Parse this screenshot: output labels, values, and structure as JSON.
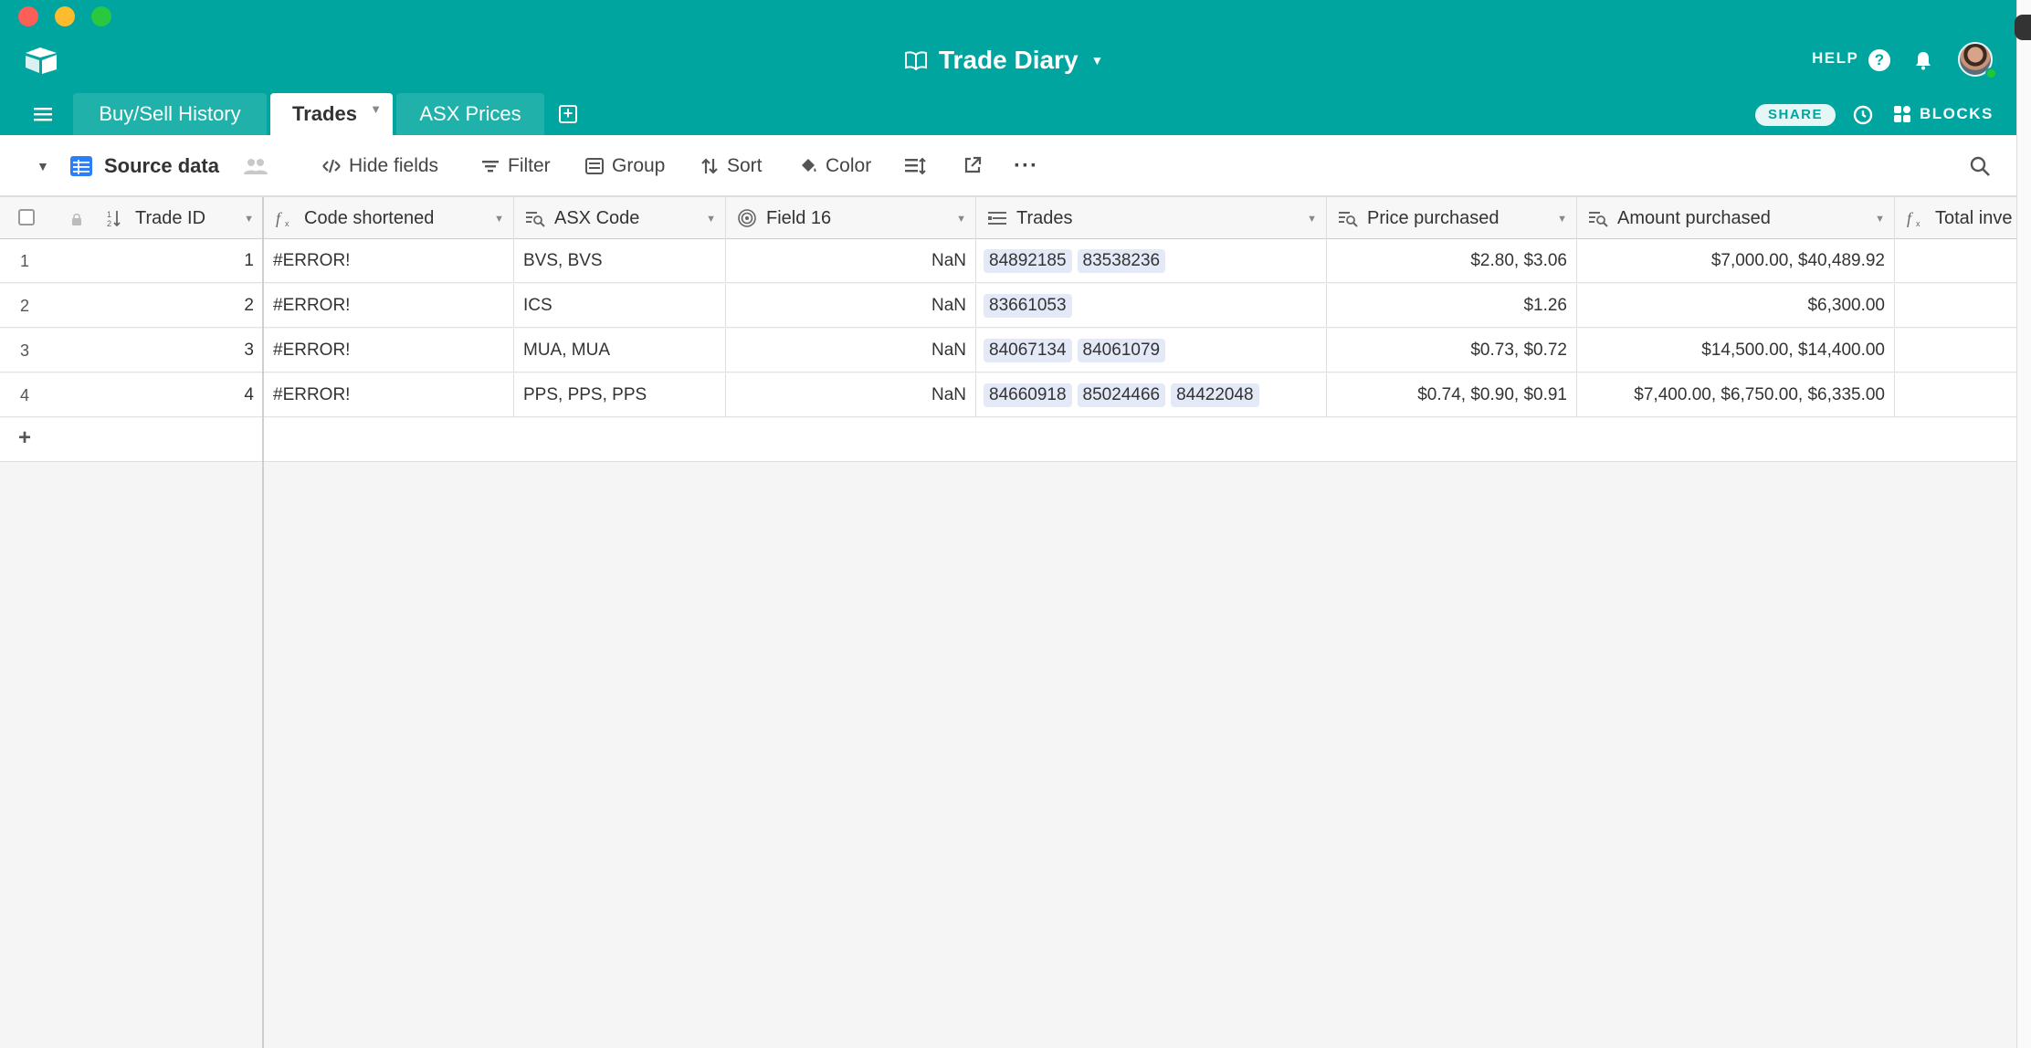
{
  "app": {
    "base_title": "Trade Diary",
    "help_label": "HELP",
    "help_icon_glyph": "?",
    "share_label": "SHARE",
    "blocks_label": "BLOCKS",
    "accent_color": "#00a5a0"
  },
  "tabs": [
    {
      "label": "Buy/Sell History",
      "active": false
    },
    {
      "label": "Trades",
      "active": true
    },
    {
      "label": "ASX Prices",
      "active": false
    }
  ],
  "toolbar": {
    "view_name": "Source data",
    "hide_fields": "Hide fields",
    "filter": "Filter",
    "group": "Group",
    "sort": "Sort",
    "color": "Color",
    "more": "···"
  },
  "columns": [
    {
      "label": "Trade ID",
      "icon": "autonumber-icon"
    },
    {
      "label": "Code shortened",
      "icon": "formula-icon"
    },
    {
      "label": "ASX Code",
      "icon": "lookup-icon"
    },
    {
      "label": "Field 16",
      "icon": "rollup-icon"
    },
    {
      "label": "Trades",
      "icon": "link-icon"
    },
    {
      "label": "Price purchased",
      "icon": "lookup-icon"
    },
    {
      "label": "Amount purchased",
      "icon": "lookup-icon"
    },
    {
      "label": "Total inve",
      "icon": "formula-icon"
    }
  ],
  "rows": [
    {
      "n": "1",
      "trade_id": "1",
      "code_shortened": "#ERROR!",
      "asx_code": "BVS, BVS",
      "field16": "NaN",
      "trades": [
        "84892185",
        "83538236"
      ],
      "price": "$2.80, $3.06",
      "amount": "$7,000.00, $40,489.92"
    },
    {
      "n": "2",
      "trade_id": "2",
      "code_shortened": "#ERROR!",
      "asx_code": "ICS",
      "field16": "NaN",
      "trades": [
        "83661053"
      ],
      "price": "$1.26",
      "amount": "$6,300.00"
    },
    {
      "n": "3",
      "trade_id": "3",
      "code_shortened": "#ERROR!",
      "asx_code": "MUA, MUA",
      "field16": "NaN",
      "trades": [
        "84067134",
        "84061079"
      ],
      "price": "$0.73, $0.72",
      "amount": "$14,500.00, $14,400.00"
    },
    {
      "n": "4",
      "trade_id": "4",
      "code_shortened": "#ERROR!",
      "asx_code": "PPS, PPS, PPS",
      "field16": "NaN",
      "trades": [
        "84660918",
        "85024466",
        "84422048"
      ],
      "price": "$0.74, $0.90, $0.91",
      "amount": "$7,400.00, $6,750.00, $6,335.00"
    }
  ],
  "add_row_label": "+"
}
